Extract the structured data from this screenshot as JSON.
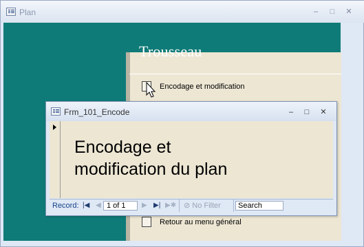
{
  "outer_window": {
    "title": "Plan",
    "controls": {
      "minimize": "–",
      "maximize": "□",
      "close": "✕"
    }
  },
  "menu_panel": {
    "title": "Trousseau",
    "items": [
      {
        "label": "Encodage et modification"
      },
      {
        "label": "Retour au menu général"
      }
    ]
  },
  "form_window": {
    "title": "Frm_101_Encode",
    "heading_line1": "Encodage et",
    "heading_line2": "modification du plan",
    "controls": {
      "minimize": "–",
      "maximize": "□",
      "close": "✕"
    }
  },
  "navigation": {
    "record_label": "Record:",
    "record_position": "1 of 1",
    "filter_label": "No Filter",
    "search_value": "Search"
  },
  "colors": {
    "teal_background": "#0f7b78",
    "panel_background": "#ece6d3",
    "window_chrome": "#dfe8f5",
    "nav_label": "#15428b"
  }
}
